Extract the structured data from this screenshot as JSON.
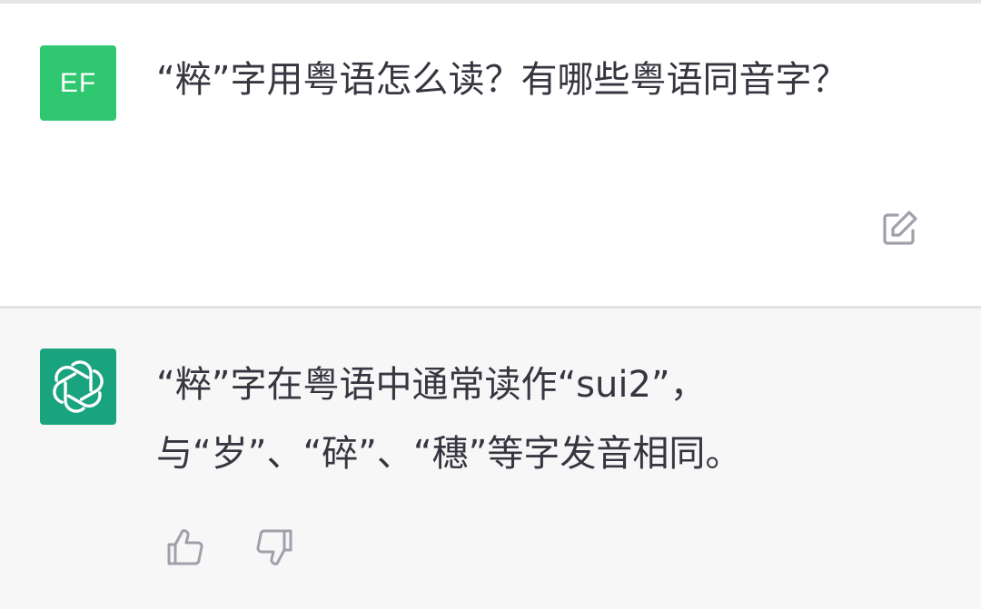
{
  "conversation": {
    "user_message": {
      "avatar_initials": "EF",
      "avatar_color": "#2fc76f",
      "text": "“粹”字用粤语怎么读？有哪些粤语同音字？"
    },
    "assistant_message": {
      "avatar_icon": "openai-logo-icon",
      "avatar_color": "#19a37f",
      "text": "“粹”字在粤语中通常读作“sui2”，与“岁”、“碎”、“穗”等字发音相同。"
    }
  },
  "icons": {
    "edit": "edit-icon",
    "like": "thumbs-up-icon",
    "dislike": "thumbs-down-icon"
  },
  "colors": {
    "user_background": "#ffffff",
    "assistant_background": "#f7f7f8",
    "text": "#363640",
    "icon_gray": "#a0a0aa"
  }
}
